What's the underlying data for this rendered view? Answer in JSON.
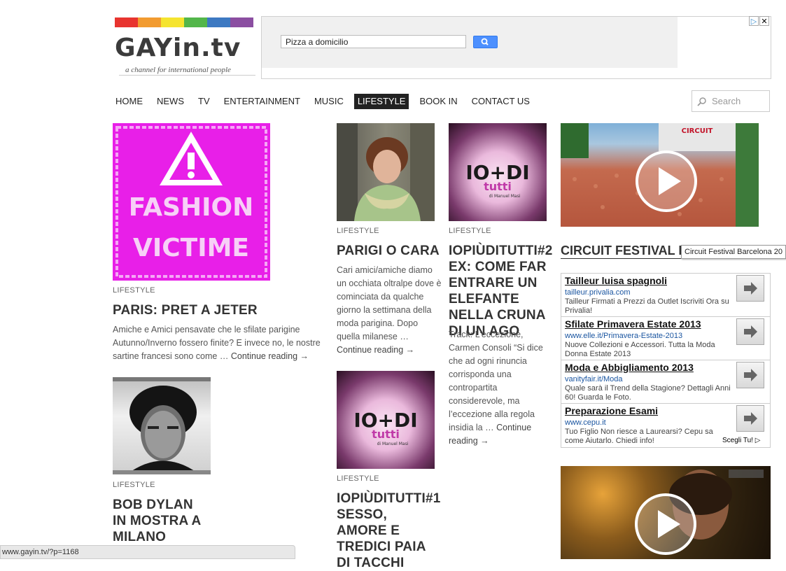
{
  "logo": {
    "text": "GAYin.tv",
    "tagline": "a channel for international people",
    "rainbow_colors": [
      "#e8342f",
      "#f29b30",
      "#f5e42f",
      "#53b64a",
      "#3d79c2",
      "#8b4ea1"
    ]
  },
  "ad_search": {
    "input_value": "Pizza a domicilio",
    "button_icon": "search-icon"
  },
  "nav": {
    "items": [
      "HOME",
      "NEWS",
      "TV",
      "ENTERTAINMENT",
      "MUSIC",
      "LIFESTYLE",
      "BOOK IN",
      "CONTACT US"
    ],
    "active": "LIFESTYLE",
    "search_placeholder": "Search"
  },
  "posts": [
    {
      "image_text": [
        "FASHION",
        "VICTIME"
      ],
      "category": "LIFESTYLE",
      "title": "PARIS: PRET A JETER",
      "excerpt": "Amiche e Amici pensavate che le sfilate parigine Autunno/Inverno fossero finite? E invece no, le nostre sartine francesi sono come …",
      "more": "Continue reading →"
    },
    {
      "category": "LIFESTYLE",
      "title": "BOB DYLAN IN MOSTRA A MILANO"
    },
    {
      "category": "LIFESTYLE",
      "title": "PARIGI O CARA",
      "excerpt": "Cari amici/amiche diamo un occhiata oltralpe dove è cominciata da qualche giorno la settimana della moda parigina. Dopo quella milanese …",
      "more": "Continue reading →"
    },
    {
      "image_text": [
        "IO+DI",
        "tutti",
        "di Manuel Masi"
      ],
      "category": "LIFESTYLE",
      "title": "IOPIÙDITUTTI#1 SESSO, AMORE E TREDICI PAIA DI TACCHI"
    },
    {
      "image_text": [
        "IO+DI",
        "tutti",
        "di Manuel Masi"
      ],
      "category": "LIFESTYLE",
      "title": "IOPIÙDITUTTI#2 EX: COME FAR ENTRARE UN ELEFANTE NELLA CRUNA DI UN AGO",
      "excerpt": "Track: L’eccezione, Carmen Consoli “Si dice che ad ogni rinuncia corrisponda una contropartita considerevole, ma l’eccezione alla regola insidia la …",
      "more": "Continue reading →"
    }
  ],
  "video": {
    "title": "CIRCUIT FESTIVAL BAR",
    "tooltip": "Circuit Festival Barcelona 20",
    "banner_text": "CIRCUIT"
  },
  "google_ads": [
    {
      "title": "Tailleur luisa spagnoli",
      "url": "tailleur.privalia.com",
      "desc": "Tailleur Firmati a Prezzi da Outlet Iscriviti Ora su Privalia!"
    },
    {
      "title": "Sfilate Primavera Estate 2013",
      "url": "www.elle.it/Primavera-Estate-2013",
      "desc": "Nuove Collezioni e Accessori. Tutta la Moda Donna Estate 2013"
    },
    {
      "title": "Moda e Abbigliamento 2013",
      "url": "vanityfair.it/Moda",
      "desc": "Quale sarà il Trend della Stagione? Dettagli Anni 60! Guarda le Foto."
    },
    {
      "title": "Preparazione Esami",
      "url": "www.cepu.it",
      "desc": "Tuo Figlio Non riesce a Laurearsi? Cepu sa come Aiutarlo. Chiedi info!"
    }
  ],
  "ads_footer": "Scegli Tu!",
  "status_bar": "www.gayin.tv/?p=1168"
}
